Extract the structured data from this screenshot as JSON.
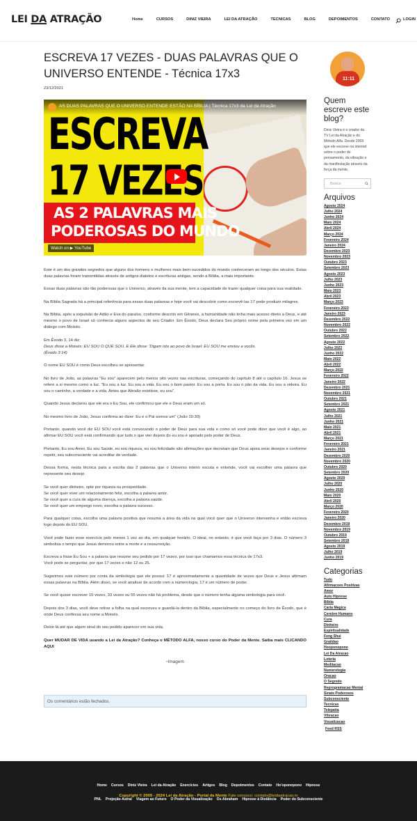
{
  "header": {
    "logo_part1": "LEI ",
    "logo_part2": "DA",
    "logo_part3": " ATRAÇÃO",
    "nav": [
      "Home",
      "CURSOS",
      "DINIZ VIEIRA",
      "LEI DA ATRAÇÃO",
      "TECNICAS",
      "BLOG",
      "DEPOIMENTOS",
      "CONTATO",
      "LOGIN"
    ],
    "search_icon": "search-icon"
  },
  "post": {
    "title": "ESCREVA 17 VEZES - DUAS PALAVRAS QUE O UNIVERSO ENTENDE - Técnica 17x3",
    "date": "23/12/2021",
    "video": {
      "title": "AS DUAS PALAVRAS QUE O UNIVERSO ENTENDE ESTÃO NA BÍBLIA | Técnica 17x3 da Lei da Atração",
      "big_line1": "ESCREVA",
      "big_line2": "17 VEZES",
      "red_line1": "AS 2 PALAVRAS MAIS",
      "red_line2": "PODEROSAS DO MUNDO",
      "watch_on": "Watch on ▶ YouTube"
    },
    "paragraphs": [
      "Este é um dos grandes segredos que alguns dos homens e mulheres mais bem-sucedidos do mundo conheceram ao longo dos séculos. Estas duas palavras foram transmitidas através de antigos dialetos e escrituras antigas, sendo a Bíblia, a mais importante.",
      "Essas duas palavras são tão poderosas que o Universo, através da sua mente, tem a capacidade de trazer qualquer coisa para sua realidade.",
      "Na Bíblia Sagrada há a principal referência para essas duas palavras e hoje você vai descobrir como escrevê-las 17 pode produzir milagres.",
      "Na Bíblia, após a expulsão de Adão e Eva do paraíso, conforme descrito em Gênesis, a humanidade não tinha mais acesso direto a Deus, e até mesmo o povo de Israel só conhecia alguns aspectos de seu Criador. Em Êxodo, Deus declara Seu próprio nome pela primeira vez em um diálogo com Moisés.",
      "Em Êxodo 3, 14 diz:",
      "Deus disse a Moisés: EU SOU O QUE SOU. E Ele disse: 'Digam isto ao povo de Israel: EU SOU me enviou a vocês.",
      "(Êxodo 3:14)",
      "O nome EU SOU é como Deus escolheu se apresentar.",
      "No livro de João, as palavras \"Eu sou\" aparecem pelo menos oito vezes nas escrituras, começando do capítulo 8 até o capítulo 16. Jesus se refere a si mesmo como a luz. \"Eu sou a luz. Eu sou a vida. Eu sou o bom pastor. Eu sou a porta. Eu sou o pão da vida. Eu sou a videira. Eu sou o caminho, a verdade e a vida. Antes que Abraão existisse, eu sou\".",
      "Quando Jesus declarou que ele era o Eu Sou, ele confirmou que ele e Deus eram um só.",
      "No mesmo livro de João, Jesus confirma ao dizer: Eu e o Pai somos um\" (João 10:30)",
      "Portanto, quando você diz EU SOU você está convocando o poder de Deus para sua vida e como só você pode dizer que você é algo, ao afirmar EU SOU você está confirmando que tudo o que vier depois do eu sou é apoiado pelo poder de Deus.",
      "Portanto, Eu sou Amor, Eu sou Saúde, eu sou riqueza, eu sou felicidade são afirmações que decretam que Deus apoia seus desejos e conforme repetir, seu subconsciente vai acreditar de verdade.",
      "Dessa forma, nesta técnica para a escrita das 2 palavras que o Universo inteiro escuta e entende, você vai escolher uma palavra que represente seu desejo.",
      "Se você quer dinheiro, opte por riqueza ou prosperidade.",
      "Se você quer viver um relacionamento feliz, escolha a palavra amor.",
      "Se você quer a cura de alguma doença, escolha a palavra saúde.",
      "Se você quer um emprego novo, escolha a palavra sucesso.",
      "Para qualquer coisa, escolha uma palavra positiva que resuma a área da vida na qual você quer que o Universo intervenha e então escreva logo depois do EU SOU.",
      "Você pode fazer esse exercício pelo menos 1 vez ao dia, em qualquer horário. O ideal, no entanto, é que você faça por 3 dias. O número 3 simboliza o tempo que Jesus demorou entre a morte e a ressurreição.",
      "Escreva a frase Eu Sou + a palavra que resume seu pedido por 17 vezes, por isso que chamamos essa técnica de 17x3.",
      "Você pode se perguntar, por que 17 vezes e não 12 ou 25.",
      "Sugerimos este número por conta da simbologia que ele possui: 17 é aproximadamente a quantidade de vezes que Deus e Jesus afirmam essas palavras na Bíblia. Além disso, se você analisar de acordo com a numerologia, 17 é um número de poder.",
      "Se você quiser escrever 15 vezes, 33 vezes ou 55 vezes não há problema, desde que o número tenha alguma simbologia para você.",
      "Depois dos 3 dias, você deve retirar a folha na qual escreveu e guardá-la dentro da Bíblia, especialmente no começo do livro de Êxodo, que é onde Deus confessa seu nome a Moisés.",
      "Deixe lá até que algum sinal do seu pedido aparecer em sua vida.",
      "Quer MUDAR DE VIDA usando a Lei da Atração? Conheça o MÉTODO ALFA, nosso curso do Poder da Mente. Saiba mais CLICANDO AQUI"
    ],
    "image_alt": "Imagem",
    "comments_closed": "Os comentários estão fechados."
  },
  "sidebar": {
    "avatar_number": "11:11",
    "who_title": "Quem escreve este blog?",
    "who_text": "Diniz Vieira é o criador da TV Lei da Atração e do Método Alfa. Desde 2009 que ele escreve na internet sobre o poder do pensamento, da vibração e da manifestação através da força da mente.",
    "search_placeholder": "Busca",
    "archives_title": "Arquivos",
    "archives": [
      "Agosto 2024",
      "Julho 2024",
      "Junho 2024",
      "Maio 2024",
      "Abril 2024",
      "Março 2024",
      "Fevereiro 2024",
      "Janeiro 2024",
      "Dezembro 2023",
      "Novembro 2023",
      "Outubro 2023",
      "Setembro 2023",
      "Agosto 2023",
      "Julho 2023",
      "Junho 2023",
      "Maio 2023",
      "Abril 2023",
      "Março 2023",
      "Fevereiro 2023",
      "Janeiro 2023",
      "Dezembro 2022",
      "Novembro 2022",
      "Outubro 2022",
      "Setembro 2022",
      "Agosto 2022",
      "Julho 2022",
      "Junho 2022",
      "Maio 2022",
      "Abril 2022",
      "Março 2022",
      "Fevereiro 2022",
      "Janeiro 2022",
      "Dezembro 2021",
      "Novembro 2021",
      "Outubro 2021",
      "Setembro 2021",
      "Agosto 2021",
      "Julho 2021",
      "Junho 2021",
      "Maio 2021",
      "Abril 2021",
      "Março 2021",
      "Fevereiro 2021",
      "Janeiro 2021",
      "Dezembro 2020",
      "Novembro 2020",
      "Outubro 2020",
      "Setembro 2020",
      "Agosto 2020",
      "Julho 2020",
      "Junho 2020",
      "Maio 2020",
      "Abril 2020",
      "Março 2020",
      "Fevereiro 2020",
      "Janeiro 2020",
      "Dezembro 2019",
      "Novembro 2019",
      "Outubro 2019",
      "Setembro 2019",
      "Agosto 2019",
      "Julho 2019",
      "Junho 2019"
    ],
    "categories_title": "Categorias",
    "categories": [
      "Tudo",
      "Afirmacoes Positivas",
      "Amor",
      "Auto Hipnose",
      "Bíblia",
      "Carta Magica",
      "Cerebro Humano",
      "Cura",
      "Dinheiro",
      "Espiritualidade",
      "Feng Shui",
      "Gratidao",
      "Hooponopono",
      "Lei Da Atracao",
      "Loteria",
      "Meditacao",
      "Numerologia",
      "Oracao",
      "O Segredo",
      "Reprogramacao Mental",
      "Sinais Poderosos",
      "Subconsciente",
      "Tecnicas",
      "Telepatia",
      "Vibracao",
      "Visualizacao"
    ],
    "feed": "Feed RSS"
  },
  "footer": {
    "row1": [
      "Home",
      "Cursos",
      "Diniz Vieira",
      "Lei da Atração",
      "Exercícios",
      "Artigos",
      "Blog",
      "Depoimentos",
      "Contato",
      "Ho'oponopono",
      "Hipnose"
    ],
    "row2": [
      "PNL",
      "Projeção Astral",
      "Viagem ao Futuro",
      "O Poder da Visualização",
      "Os Abraham",
      "Hipnose à Distância",
      "Poder do Subconsciente"
    ],
    "copyright": "Copyright © 2009 - 2024 Lei da Atração - Portal da Mente",
    "contact": " Fale conosco: contato@leidaatracao.tv"
  },
  "colors": {
    "accent_red": "#e5141a",
    "youtube_red": "#ff0000",
    "footer_bg": "#1b1b1b",
    "footer_copy": "#e4c22a",
    "notice_bg": "#e9f1f8"
  }
}
